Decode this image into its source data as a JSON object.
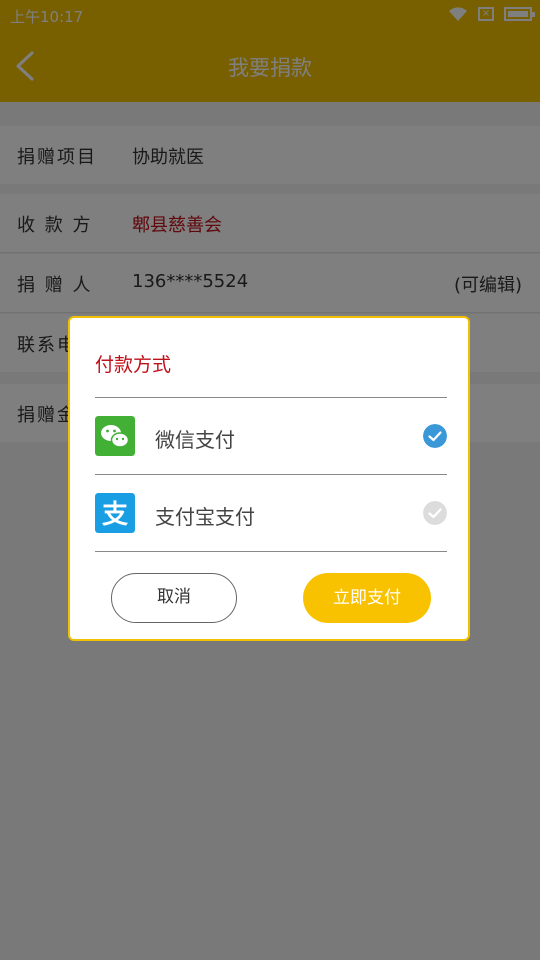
{
  "status_bar": {
    "time": "上午10:17"
  },
  "header": {
    "title": "我要捐款"
  },
  "form": {
    "project": {
      "label": "捐赠项目",
      "value": "协助就医"
    },
    "payee": {
      "label": "收 款 方",
      "value": "郫县慈善会"
    },
    "donor": {
      "label": "捐 赠 人",
      "value": "136****5524",
      "hint": "(可编辑)"
    },
    "contact": {
      "label": "联系电"
    },
    "amount": {
      "label": "捐赠金"
    }
  },
  "dialog": {
    "title": "付款方式",
    "options": [
      {
        "label": "微信支付",
        "icon": "wechat-pay-icon",
        "selected": true
      },
      {
        "label": "支付宝支付",
        "icon": "alipay-icon",
        "selected": false
      }
    ],
    "cancel_label": "取消",
    "pay_label": "立即支付"
  },
  "colors": {
    "accent": "#f0c100",
    "title_red": "#c0101a",
    "check_blue": "#3a98d8"
  }
}
